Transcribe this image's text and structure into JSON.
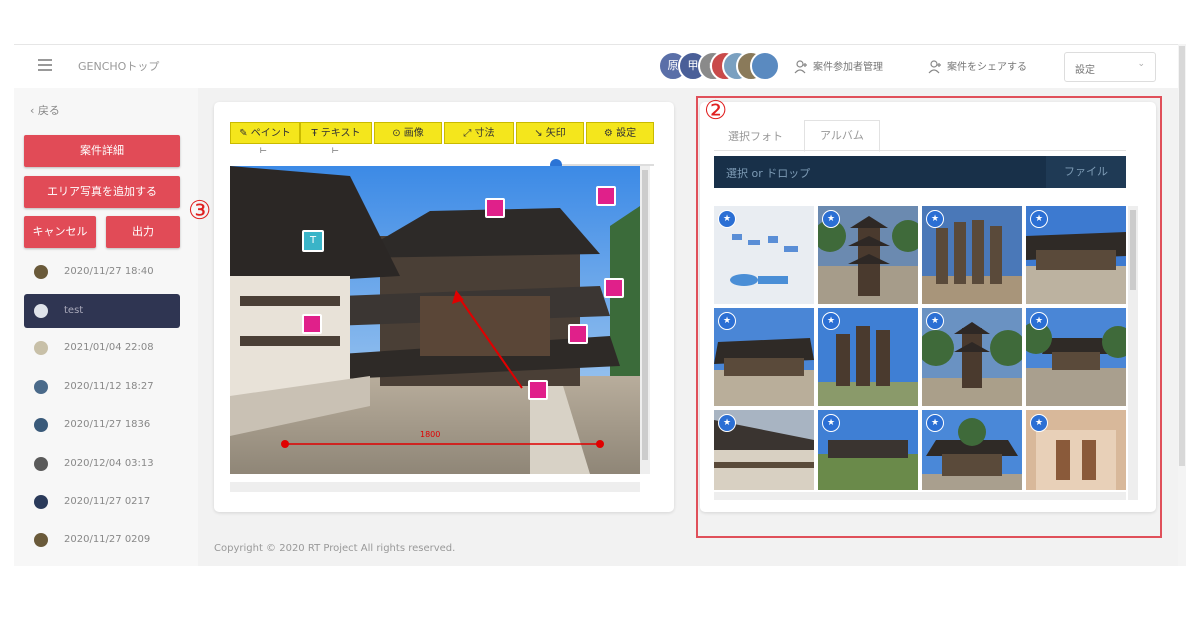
{
  "header": {
    "app_title": "GENCHOトップ",
    "avatars": [
      "原",
      "甲",
      "山",
      "",
      "",
      "",
      ""
    ],
    "avatar_colors": [
      "#5a6fa8",
      "#4a5f98",
      "#8a8a8a",
      "#c94a4a",
      "#7aa0c0",
      "#8a7a5a",
      "#5a8ac0"
    ],
    "participants_label": "案件参加者管理",
    "share_label": "案件をシェアする",
    "settings_value": "設定"
  },
  "sidebar": {
    "back_label": "戻る",
    "case_detail_label": "案件詳細",
    "add_area_label": "エリア写真を追加する",
    "cancel_label": "キャンセル",
    "output_label": "出力",
    "history": [
      "2020/11/27 18:40",
      "test",
      "2021/01/04 22:08",
      "2020/11/12 18:27",
      "2020/11/27 1836",
      "2020/12/04 03:13",
      "2020/11/27 0217",
      "2020/11/27 0209"
    ]
  },
  "editor": {
    "tools": [
      "ペイント",
      "テキスト",
      "画像",
      "寸法",
      "矢印",
      "設定"
    ],
    "dimension_label": "1800"
  },
  "album": {
    "tab_selected_photo": "選択フォト",
    "tab_album": "アルバム",
    "upload_placeholder": "選択 or ドロップ",
    "file_button": "ファイル"
  },
  "annotations": {
    "circle_2": "②",
    "circle_3": "③"
  },
  "footer": {
    "copyright": "Copyright © 2020 RT Project All rights reserved."
  },
  "colors": {
    "accent_red": "#e14b57",
    "nav_dark": "#2f3552",
    "tool_yellow": "#f4e61c",
    "upload_bar": "#183049",
    "highlight": "#e02020"
  }
}
